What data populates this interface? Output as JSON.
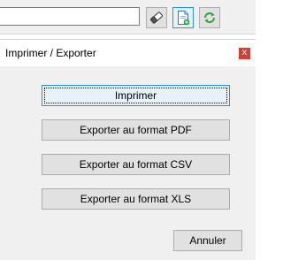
{
  "toolbar": {
    "search_value": "",
    "icons": {
      "eraser": "eraser-icon",
      "export": "export-document-icon",
      "refresh": "refresh-icon"
    },
    "colors": {
      "active_border": "#2f8de4",
      "active_fill": "#e5f1fb"
    }
  },
  "dialog": {
    "title": "Imprimer / Exporter",
    "close_label": "x",
    "close_color": "#c7463a",
    "buttons": {
      "print": "Imprimer",
      "export_pdf": "Exporter au format PDF",
      "export_csv": "Exporter au format CSV",
      "export_xls": "Exporter au format XLS"
    },
    "cancel": "Annuler"
  }
}
